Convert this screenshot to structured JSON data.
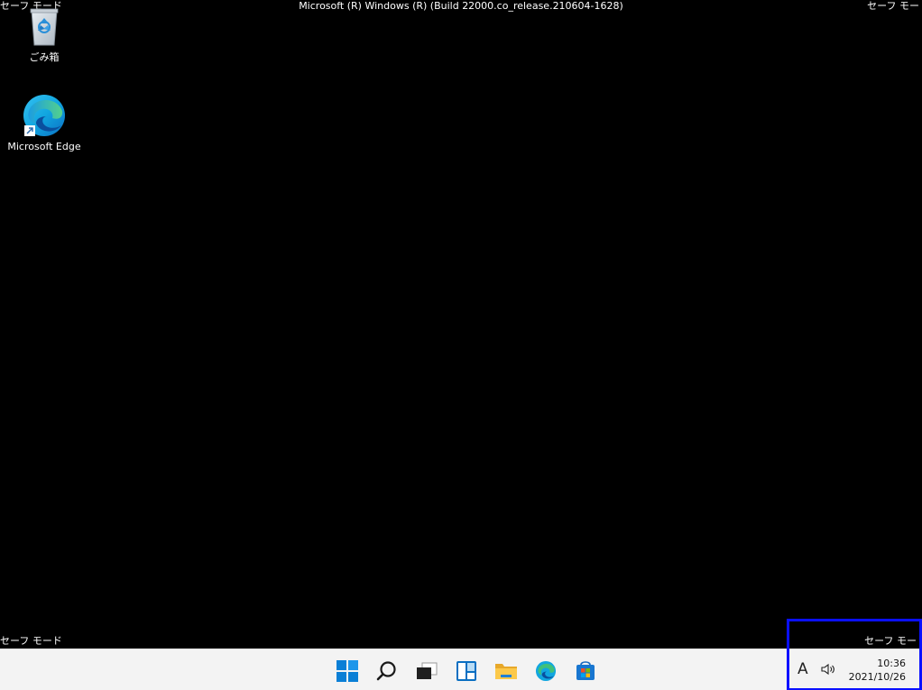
{
  "safe_mode_label": "セーフ モード",
  "safe_mode_label_clipped": "セーフ モー",
  "build_title": "Microsoft (R) Windows (R) (Build 22000.co_release.210604-1628)",
  "desktop_icons": [
    {
      "label": "ごみ箱",
      "icon": "recycle-bin-icon"
    },
    {
      "label": "Microsoft Edge",
      "icon": "edge-icon"
    }
  ],
  "taskbar": {
    "buttons": [
      {
        "name": "start",
        "icon": "windows-logo-icon"
      },
      {
        "name": "search",
        "icon": "search-icon"
      },
      {
        "name": "task-view",
        "icon": "task-view-icon"
      },
      {
        "name": "widgets",
        "icon": "widgets-icon"
      },
      {
        "name": "file-explorer",
        "icon": "folder-icon"
      },
      {
        "name": "edge",
        "icon": "edge-icon"
      },
      {
        "name": "store",
        "icon": "store-icon"
      }
    ]
  },
  "tray": {
    "ime": "A",
    "time": "10:36",
    "date": "2021/10/26"
  },
  "colors": {
    "desktop_bg": "#000000",
    "taskbar_bg": "#f3f3f3",
    "highlight": "#0a10ff",
    "windows_blue": "#0078d4"
  }
}
